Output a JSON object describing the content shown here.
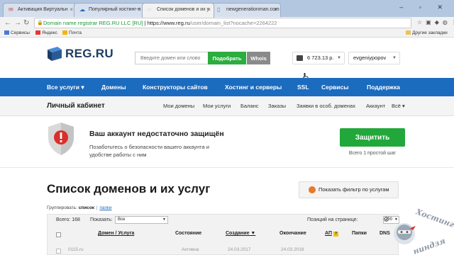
{
  "browser": {
    "tabs": [
      {
        "title": "Активация Виртуальн",
        "favicon": "gmail-icon"
      },
      {
        "title": "Популярный хостинг-п",
        "favicon": "cloud-icon"
      },
      {
        "title": "Список доменов и их у",
        "favicon": "loading-icon"
      },
      {
        "title": "newgenerationman.com",
        "favicon": "page-icon"
      }
    ],
    "address": {
      "site_name": "Domain name registrar REG.RU LLC [RU]",
      "separator": " | ",
      "url_host": "https://www.reg.ru",
      "url_path": "/user/domain_list?nocache=2264222"
    },
    "bookmarks": [
      {
        "label": "Сервисы",
        "icon": "apps-icon"
      },
      {
        "label": "Яндекс",
        "icon": "yandex-icon"
      },
      {
        "label": "Почта",
        "icon": "mail-icon"
      }
    ],
    "other_bookmarks": "Другие закладки"
  },
  "header": {
    "logo_text": "REG.RU",
    "search_placeholder": "Введите домен или слово",
    "search_button": "Подобрать",
    "whois_button": "Whois",
    "balance": "6 723.13 р.",
    "username": "evgeniypopov"
  },
  "mainnav": [
    "Все услуги ▾",
    "Домены",
    "Конструкторы сайтов",
    "Хостинг и серверы",
    "SSL",
    "Сервисы",
    "Поддержка"
  ],
  "subnav": {
    "title": "Личный кабинет",
    "links": [
      "Мои домены",
      "Мои услуги",
      "Баланс",
      "Заказы",
      "Заявки в особ. доменах",
      "Аккаунт",
      "Всё ▾"
    ]
  },
  "security": {
    "title": "Ваш аккаунт недостаточно защищён",
    "text": "Позаботьтесь о безопасности вашего аккаунта и удобстве работы с ним",
    "button": "Защитить",
    "note": "Всего 1 простой шаг"
  },
  "list": {
    "title": "Список доменов и их услуг",
    "filter_button": "Показать фильтр по услугам",
    "grouping_label": "Группировать:",
    "grouping_active": "список",
    "grouping_separator": "|",
    "grouping_other": "папки",
    "total": "Всего: 168",
    "show_label": "Показать:",
    "show_value": "Все",
    "per_page_label": "Позиций на странице:",
    "per_page_value": "200",
    "columns": [
      "Домен / Услуга",
      "Состояние",
      "Создание ▼",
      "Окончание",
      "АП",
      "Папки",
      "DNS"
    ],
    "first_row": {
      "domain": "0115.ru",
      "state": "Активна",
      "created": "24.03.2017",
      "expires": "24.03.2018"
    }
  },
  "watermark": {
    "line1": "Хостинг-",
    "line2": "ниндзя"
  },
  "colors": {
    "nav_blue": "#1b6bbf",
    "green": "#22a83a",
    "logo_navy": "#1d3b63",
    "warn_red": "#d9302b"
  }
}
